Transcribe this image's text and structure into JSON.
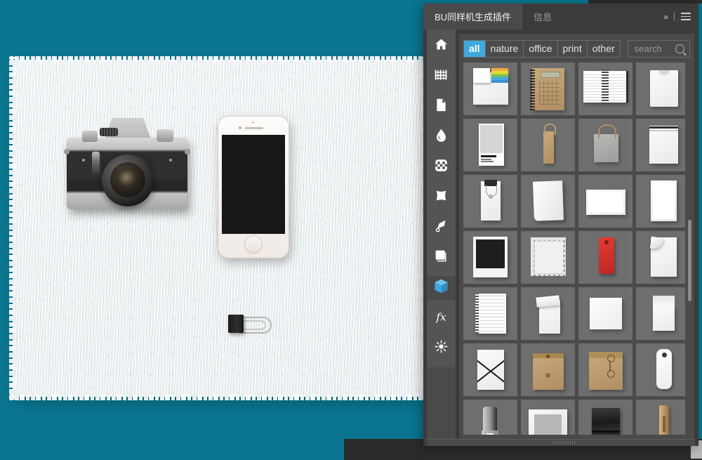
{
  "app": {
    "accent_color": "#3fa9dd",
    "panel_bg": "#4a4a4a",
    "canvas_color": "#0a7590"
  },
  "panel": {
    "tabs": [
      {
        "label": "BU同样机生成插件",
        "active": true
      },
      {
        "label": "信息",
        "active": false
      }
    ],
    "tools": {
      "expand_label": "»",
      "menu_label": "menu"
    },
    "rail": {
      "items": [
        {
          "name": "home-icon",
          "label": "home",
          "selected": false
        },
        {
          "name": "pattern-icon",
          "label": "pattern",
          "selected": false
        },
        {
          "name": "page-icon",
          "label": "page",
          "selected": false
        },
        {
          "name": "droplet-icon",
          "label": "droplet",
          "selected": false
        },
        {
          "name": "checker-icon",
          "label": "checker",
          "selected": false
        },
        {
          "name": "pillow-icon",
          "label": "pillow",
          "selected": false
        },
        {
          "name": "scroll-icon",
          "label": "scroll",
          "selected": false
        },
        {
          "name": "square-stack-icon",
          "label": "square",
          "selected": false
        },
        {
          "name": "cube-icon",
          "label": "cube",
          "selected": true
        },
        {
          "name": "fx-icon",
          "label": "fx",
          "selected": false
        },
        {
          "name": "sun-icon",
          "label": "light",
          "selected": false
        }
      ]
    },
    "filters": {
      "chips": [
        {
          "label": "all",
          "active": true
        },
        {
          "label": "nature",
          "active": false
        },
        {
          "label": "office",
          "active": false
        },
        {
          "label": "print",
          "active": false
        },
        {
          "label": "other",
          "active": false
        }
      ]
    },
    "search": {
      "value": "",
      "placeholder": "search",
      "icon": "search-icon"
    },
    "grid": {
      "columns": 4,
      "items": [
        {
          "id": 1,
          "name": "sticky-notes-pad",
          "art": "sticky"
        },
        {
          "id": 2,
          "name": "spiral-notebook-kraft",
          "art": "spiral-kraft"
        },
        {
          "id": 3,
          "name": "open-spiral-notebook",
          "art": "open-notebook"
        },
        {
          "id": 4,
          "name": "card-sleeve",
          "art": "sleeve"
        },
        {
          "id": 5,
          "name": "pantone-swatch-card",
          "art": "pantone",
          "caption": "PANTONE®"
        },
        {
          "id": 6,
          "name": "tall-kraft-bag",
          "art": "tallbag"
        },
        {
          "id": 7,
          "name": "grey-shopping-bag",
          "art": "shopbag"
        },
        {
          "id": 8,
          "name": "sealed-envelope-white",
          "art": "sealenv"
        },
        {
          "id": 9,
          "name": "clipped-note",
          "art": "clipnote"
        },
        {
          "id": 10,
          "name": "curled-sheet",
          "art": "curlsheet"
        },
        {
          "id": 11,
          "name": "landscape-card",
          "art": "landcard"
        },
        {
          "id": 12,
          "name": "portrait-card",
          "art": "portcard"
        },
        {
          "id": 13,
          "name": "polaroid-frame-black",
          "art": "polaroid"
        },
        {
          "id": 14,
          "name": "postage-stamp",
          "art": "stamp"
        },
        {
          "id": 15,
          "name": "red-hang-tag",
          "art": "redtag"
        },
        {
          "id": 16,
          "name": "page-curl-corner",
          "art": "cornercurl"
        },
        {
          "id": 17,
          "name": "lined-notepad",
          "art": "linedpad"
        },
        {
          "id": 18,
          "name": "flip-notepad",
          "art": "flippad"
        },
        {
          "id": 19,
          "name": "square-card",
          "art": "sqcard"
        },
        {
          "id": 20,
          "name": "folded-card-open",
          "art": "foldcard"
        },
        {
          "id": 21,
          "name": "elastic-folder",
          "art": "elastic"
        },
        {
          "id": 22,
          "name": "kraft-envelope-button",
          "art": "kraftbtn"
        },
        {
          "id": 23,
          "name": "kraft-string-envelope",
          "art": "kraftstring"
        },
        {
          "id": 24,
          "name": "white-hang-tag",
          "art": "whitetag"
        },
        {
          "id": 25,
          "name": "stapler",
          "art": "stapler"
        },
        {
          "id": 26,
          "name": "picture-frame",
          "art": "frame"
        },
        {
          "id": 27,
          "name": "black-leather-fabric",
          "art": "leather"
        },
        {
          "id": 28,
          "name": "wooden-clothespin",
          "art": "clothespin"
        }
      ]
    },
    "scrollbar": {
      "position": "vertical-right"
    }
  },
  "canvas": {
    "objects": [
      {
        "name": "paper-sheet-background",
        "label": "torn white paper sheet"
      },
      {
        "name": "film-camera",
        "label": "vintage SLR camera"
      },
      {
        "name": "smartphone",
        "label": "white smartphone"
      },
      {
        "name": "binder-clip",
        "label": "black binder clip"
      }
    ]
  }
}
